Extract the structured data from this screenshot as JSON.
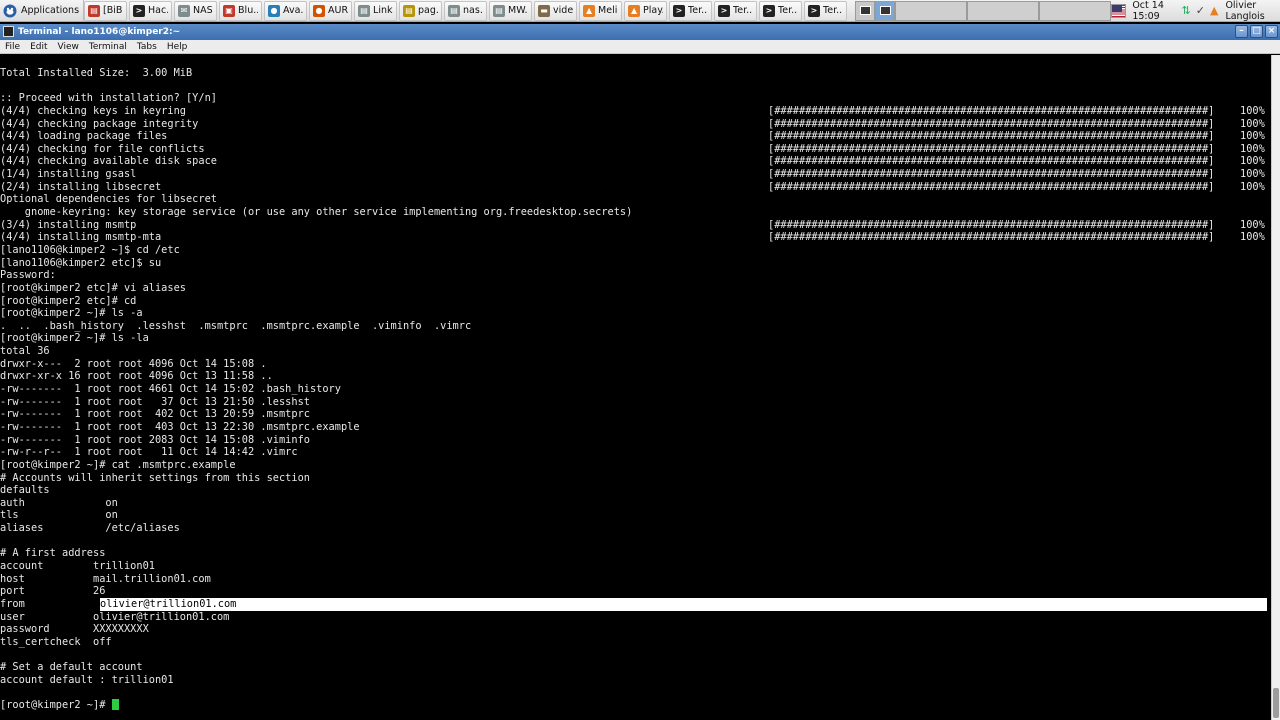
{
  "panel": {
    "app_menu_label": "Applications",
    "tasks": [
      {
        "label": "[BiB...",
        "icon": "document-icon",
        "color": "#c0392b"
      },
      {
        "label": "Hac...",
        "icon": "terminal-icon",
        "color": "#222222"
      },
      {
        "label": "NAS...",
        "icon": "mail-icon",
        "color": "#7f8c8d"
      },
      {
        "label": "Blu...",
        "icon": "pdf-icon",
        "color": "#c0392b"
      },
      {
        "label": "Ava...",
        "icon": "browser-icon",
        "color": "#2980b9"
      },
      {
        "label": "AUR...",
        "icon": "browser-icon",
        "color": "#d35400"
      },
      {
        "label": "Link...",
        "icon": "document-icon",
        "color": "#7f8c8d"
      },
      {
        "label": "pag...",
        "icon": "document-icon",
        "color": "#b7950b"
      },
      {
        "label": "nas...",
        "icon": "document-icon",
        "color": "#7f8c8d"
      },
      {
        "label": "MW...",
        "icon": "document-icon",
        "color": "#7f8c8d"
      },
      {
        "label": "vide...",
        "icon": "folder-icon",
        "color": "#7f6a4a"
      },
      {
        "label": "Meli...",
        "icon": "vlc-icon",
        "color": "#e67e22"
      },
      {
        "label": "Play...",
        "icon": "vlc-icon",
        "color": "#e67e22"
      },
      {
        "label": "Ter...",
        "icon": "terminal-icon",
        "color": "#222222"
      },
      {
        "label": "Ter...",
        "icon": "terminal-icon",
        "color": "#222222"
      },
      {
        "label": "Ter...",
        "icon": "terminal-icon",
        "color": "#222222"
      },
      {
        "label": "Ter...",
        "icon": "terminal-icon",
        "color": "#222222"
      }
    ],
    "clock": "Oct 14 15:09",
    "user": "Olivier Langlois"
  },
  "window": {
    "title": "Terminal - lano1106@kimper2:~",
    "menu": [
      "File",
      "Edit",
      "View",
      "Terminal",
      "Tabs",
      "Help"
    ]
  },
  "terminal": {
    "lines": [
      {
        "t": "Total Installed Size:  3.00 MiB"
      },
      {
        "t": ""
      },
      {
        "t": ":: Proceed with installation? [Y/n]"
      },
      {
        "t": "(4/4) checking keys in keyring",
        "bar": "[######################################################################]",
        "pct": "100%"
      },
      {
        "t": "(4/4) checking package integrity",
        "bar": "[######################################################################]",
        "pct": "100%"
      },
      {
        "t": "(4/4) loading package files",
        "bar": "[######################################################################]",
        "pct": "100%"
      },
      {
        "t": "(4/4) checking for file conflicts",
        "bar": "[######################################################################]",
        "pct": "100%"
      },
      {
        "t": "(4/4) checking available disk space",
        "bar": "[######################################################################]",
        "pct": "100%"
      },
      {
        "t": "(1/4) installing gsasl",
        "bar": "[######################################################################]",
        "pct": "100%"
      },
      {
        "t": "(2/4) installing libsecret",
        "bar": "[######################################################################]",
        "pct": "100%"
      },
      {
        "t": "Optional dependencies for libsecret"
      },
      {
        "t": "    gnome-keyring: key storage service (or use any other service implementing org.freedesktop.secrets)"
      },
      {
        "t": "(3/4) installing msmtp",
        "bar": "[######################################################################]",
        "pct": "100%"
      },
      {
        "t": "(4/4) installing msmtp-mta",
        "bar": "[######################################################################]",
        "pct": "100%"
      },
      {
        "t": "[lano1106@kimper2 ~]$ cd /etc"
      },
      {
        "t": "[lano1106@kimper2 etc]$ su"
      },
      {
        "t": "Password:"
      },
      {
        "t": "[root@kimper2 etc]# vi aliases"
      },
      {
        "t": "[root@kimper2 etc]# cd"
      },
      {
        "t": "[root@kimper2 ~]# ls -a"
      },
      {
        "t": ".  ..  .bash_history  .lesshst  .msmtprc  .msmtprc.example  .viminfo  .vimrc"
      },
      {
        "t": "[root@kimper2 ~]# ls -la"
      },
      {
        "t": "total 36"
      },
      {
        "t": "drwxr-x---  2 root root 4096 Oct 14 15:08 ."
      },
      {
        "t": "drwxr-xr-x 16 root root 4096 Oct 13 11:58 .."
      },
      {
        "t": "-rw-------  1 root root 4661 Oct 14 15:02 .bash_history"
      },
      {
        "t": "-rw-------  1 root root   37 Oct 13 21:50 .lesshst"
      },
      {
        "t": "-rw-------  1 root root  402 Oct 13 20:59 .msmtprc"
      },
      {
        "t": "-rw-------  1 root root  403 Oct 13 22:30 .msmtprc.example"
      },
      {
        "t": "-rw-------  1 root root 2083 Oct 14 15:08 .viminfo"
      },
      {
        "t": "-rw-r--r--  1 root root   11 Oct 14 14:42 .vimrc"
      },
      {
        "t": "[root@kimper2 ~]# cat .msmtprc.example"
      },
      {
        "t": "# Accounts will inherit settings from this section"
      },
      {
        "t": "defaults"
      },
      {
        "t": "auth             on"
      },
      {
        "t": "tls              on"
      },
      {
        "t": "aliases          /etc/aliases"
      },
      {
        "t": ""
      },
      {
        "t": "# A first address"
      },
      {
        "t": "account        trillion01"
      },
      {
        "t": "host           mail.trillion01.com"
      },
      {
        "t": "port           26"
      },
      {
        "t": "from           ",
        "sel": "olivier@trillion01.com"
      },
      {
        "t": "user           olivier@trillion01.com"
      },
      {
        "t": "password       XXXXXXXXX"
      },
      {
        "t": "tls_certcheck  off"
      },
      {
        "t": ""
      },
      {
        "t": "# Set a default account"
      },
      {
        "t": "account default : trillion01"
      },
      {
        "t": ""
      },
      {
        "t": "[root@kimper2 ~]# ",
        "cursor": true
      }
    ]
  },
  "colors": {
    "terminal_bg": "#000000",
    "terminal_fg": "#e8e8e8",
    "cursor": "#2ecc40",
    "title_bar": "#4a7dbd"
  }
}
